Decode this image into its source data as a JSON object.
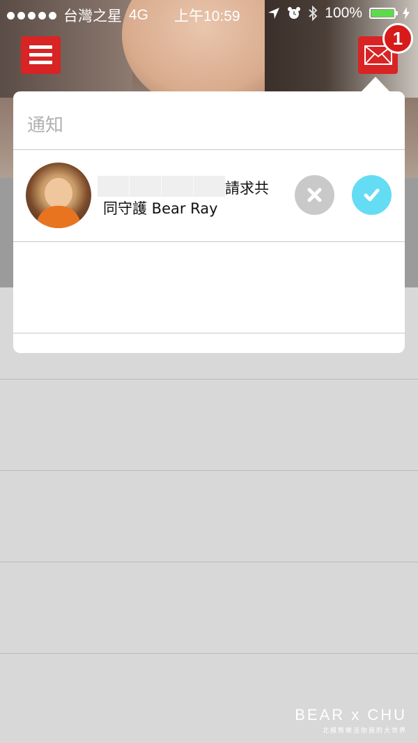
{
  "status_bar": {
    "carrier": "台灣之星",
    "network": "4G",
    "time": "上午10:59",
    "battery": "100%"
  },
  "header": {
    "menu_icon": "hamburger-menu-icon",
    "mail_icon": "envelope-icon",
    "notification_count": "1",
    "accent_color": "#d82424"
  },
  "notifications_panel": {
    "title": "通知",
    "items": [
      {
        "text_line1": "請求共",
        "text_line2": "同守護 Bear Ray",
        "decline_icon": "x-icon",
        "accept_icon": "checkmark-icon",
        "accept_color": "#64dcf3",
        "decline_color": "#c9c9c9"
      }
    ]
  },
  "watermark": {
    "title": "BEAR x CHU",
    "subtitle": "北極熊樂活你我的大世界"
  }
}
